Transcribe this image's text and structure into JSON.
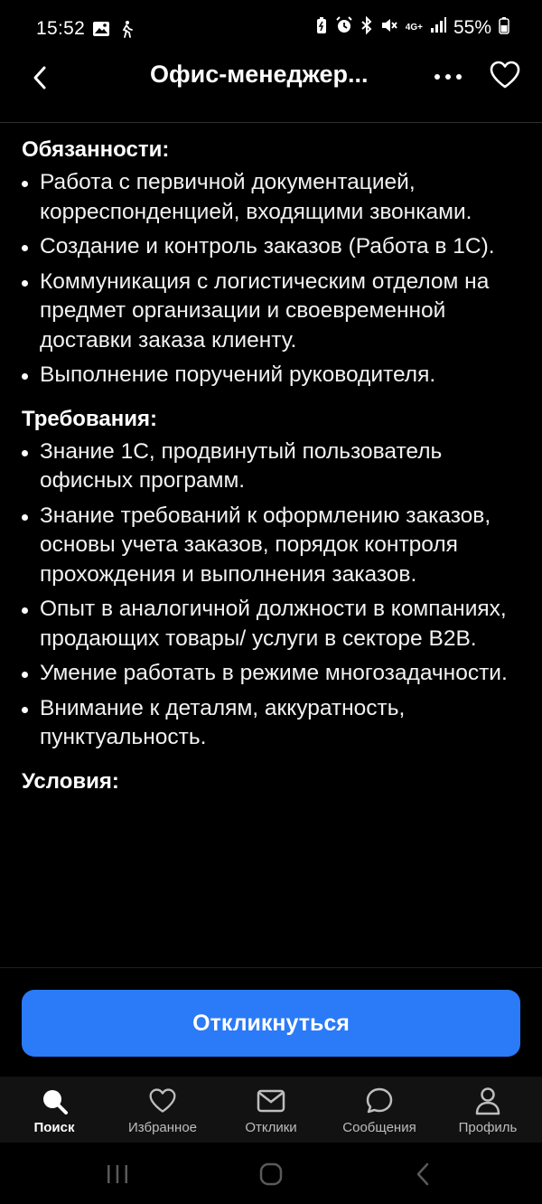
{
  "status_bar": {
    "time": "15:52",
    "battery": "55%",
    "network": "4G+"
  },
  "header": {
    "title": "Офис-менеджер..."
  },
  "sections": [
    {
      "title": "Обязанности:",
      "items": [
        "Работа с первичной документацией, корреспонденцией, входящими звонками.",
        "Создание и контроль заказов (Работа в 1С).",
        "Коммуникация с логистическим отделом на предмет организации и своевременной доставки заказа клиенту.",
        "Выполнение поручений руководителя."
      ]
    },
    {
      "title": "Требования:",
      "items": [
        "Знание 1С, продвинутый пользователь офисных программ.",
        "Знание требований к оформлению заказов, основы учета заказов, порядок контроля прохождения и выполнения заказов.",
        "Опыт в аналогичной должности в компаниях, продающих товары/ услуги в секторе B2B.",
        "Умение работать в режиме многозадачности.",
        "Внимание к деталям, аккуратность, пунктуальность."
      ]
    },
    {
      "title": "Условия:",
      "items": []
    }
  ],
  "apply_button": "Откликнуться",
  "bottom_nav": [
    {
      "label": "Поиск",
      "icon": "search-icon",
      "active": true
    },
    {
      "label": "Избранное",
      "icon": "heart-icon",
      "active": false
    },
    {
      "label": "Отклики",
      "icon": "mail-icon",
      "active": false
    },
    {
      "label": "Сообщения",
      "icon": "chat-icon",
      "active": false
    },
    {
      "label": "Профиль",
      "icon": "profile-icon",
      "active": false
    }
  ],
  "colors": {
    "accent": "#2b7af7",
    "background": "#000000",
    "nav_background": "#121212"
  }
}
